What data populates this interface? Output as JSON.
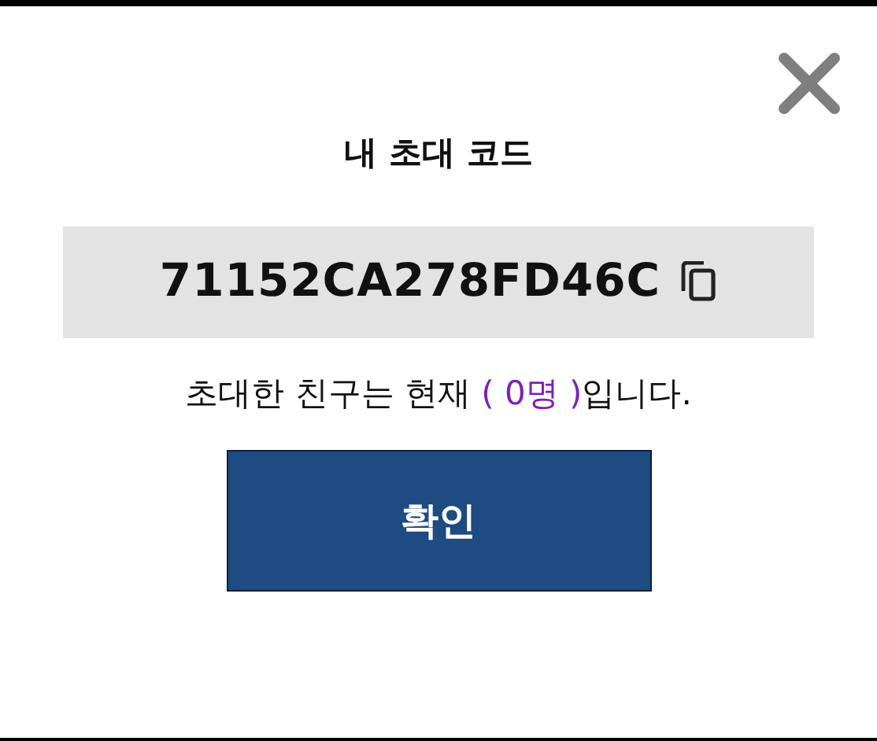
{
  "dialog": {
    "title": "내 초대 코드",
    "code": "71152CA278FD46C",
    "message": {
      "before": "초대한 친구는 현재 ",
      "count": "( 0명 )",
      "after": "입니다."
    },
    "buttons": [
      "확인"
    ]
  }
}
